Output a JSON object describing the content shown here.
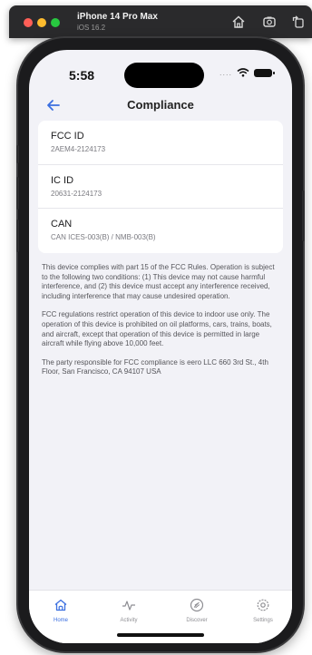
{
  "simulator": {
    "device": "iPhone 14 Pro Max",
    "os": "iOS 16.2",
    "tools": [
      "home-icon",
      "screenshot-icon",
      "rotate-icon"
    ]
  },
  "status_bar": {
    "time": "5:58",
    "signal": "...."
  },
  "nav": {
    "title": "Compliance",
    "back_icon": "arrow-left-icon"
  },
  "rows": [
    {
      "label": "FCC ID",
      "value": "2AEM4-2124173"
    },
    {
      "label": "IC ID",
      "value": "20631-2124173"
    },
    {
      "label": "CAN",
      "value": "CAN ICES-003(B) / NMB-003(B)"
    }
  ],
  "notes": [
    "This device complies with part 15 of the FCC Rules. Operation is subject to the following two conditions: (1) This device may not cause harmful interference, and (2) this device must accept any interference received, including interference that may cause undesired operation.",
    "FCC regulations restrict operation of this device to indoor use only. The operation of this device is prohibited on oil platforms, cars, trains, boats, and aircraft, except that operation of this device is permitted in large aircraft while flying above 10,000 feet.",
    "The party responsible for FCC compliance is eero LLC 660 3rd St., 4th Floor, San Francisco, CA 94107 USA"
  ],
  "tabs": [
    {
      "label": "Home",
      "icon": "home-icon",
      "active": true
    },
    {
      "label": "Activity",
      "icon": "activity-icon",
      "active": false
    },
    {
      "label": "Discover",
      "icon": "discover-icon",
      "active": false
    },
    {
      "label": "Settings",
      "icon": "gear-icon",
      "active": false
    }
  ],
  "colors": {
    "accent": "#3b6fe0",
    "background": "#f2f2f7",
    "card": "#ffffff",
    "muted": "#7a7a80"
  }
}
